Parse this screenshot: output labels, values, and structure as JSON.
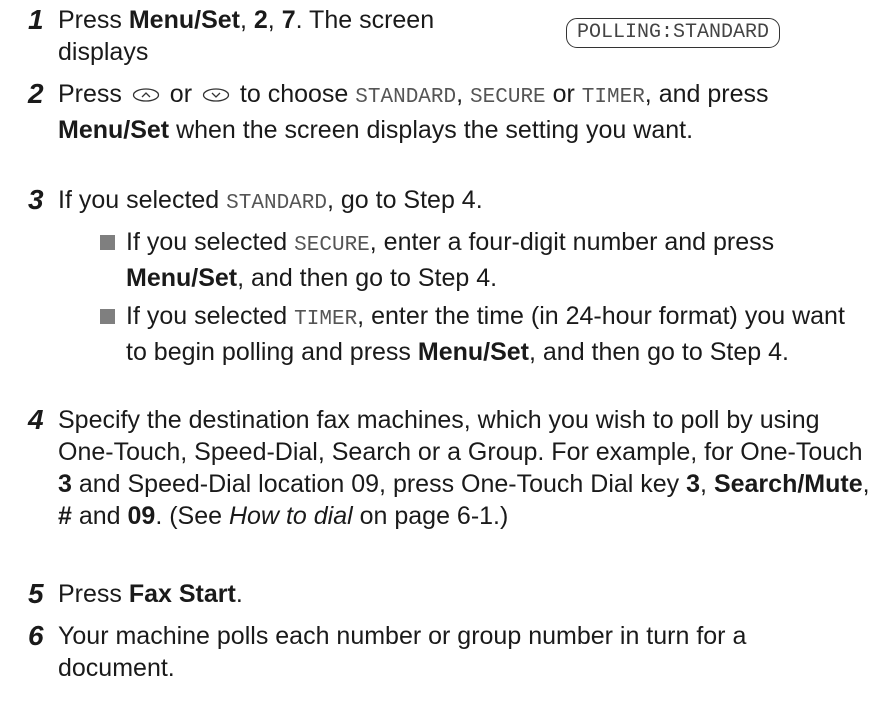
{
  "display": {
    "lcd_text": "POLLING:STANDARD"
  },
  "steps": [
    {
      "number": "1",
      "parts": {
        "t1": "Press ",
        "b1": "Menu/Set",
        "t2": ", ",
        "b2": "2",
        "t3": ", ",
        "b3": "7",
        "t4": ". The screen",
        "t5": "displays"
      }
    },
    {
      "number": "2",
      "parts": {
        "t1": "Press ",
        "t2": " or ",
        "t3": " to choose ",
        "m1": "STANDARD",
        "t4": ", ",
        "m2": "SECURE",
        "t5": " or ",
        "m3": "TIMER",
        "t6": ", and press ",
        "b1": "Menu/Set",
        "t7": " when the screen displays the setting you want."
      }
    },
    {
      "number": "3",
      "parts": {
        "t1": "If you selected ",
        "m1": "STANDARD",
        "t2": ", go to Step 4."
      },
      "bullets": [
        {
          "t1": "If you selected ",
          "m1": "SECURE",
          "t2": ", enter a four-digit number and press ",
          "b1": "Menu/Set",
          "t3": ", and then go to Step 4."
        },
        {
          "t1": "If you selected ",
          "m1": "TIMER",
          "t2": ", enter the time (in 24-hour format) you want to begin polling and press ",
          "b1": "Menu/Set",
          "t3": ", and then go to Step 4."
        }
      ]
    },
    {
      "number": "4",
      "parts": {
        "t1": "Specify the destination fax machines, which you wish to poll by using One-Touch, Speed-Dial, Search or a Group. For example, for One-Touch ",
        "b1": "3",
        "t2": " and Speed-Dial location 09, press One-Touch Dial key ",
        "b2": "3",
        "t3": ", ",
        "b3": "Search/Mute",
        "t4": ", ",
        "b4": "#",
        "t5": " and ",
        "b5": "09",
        "t6": ". (See ",
        "i1": "How to dial",
        "t7": " on page 6-1.)"
      }
    },
    {
      "number": "5",
      "parts": {
        "t1": "Press ",
        "b1": "Fax Start",
        "t2": "."
      }
    },
    {
      "number": "6",
      "parts": {
        "t1": "Your machine polls each number or group number in turn for a document."
      }
    }
  ],
  "icons": {
    "up": "navigation-up-icon",
    "down": "navigation-down-icon"
  }
}
